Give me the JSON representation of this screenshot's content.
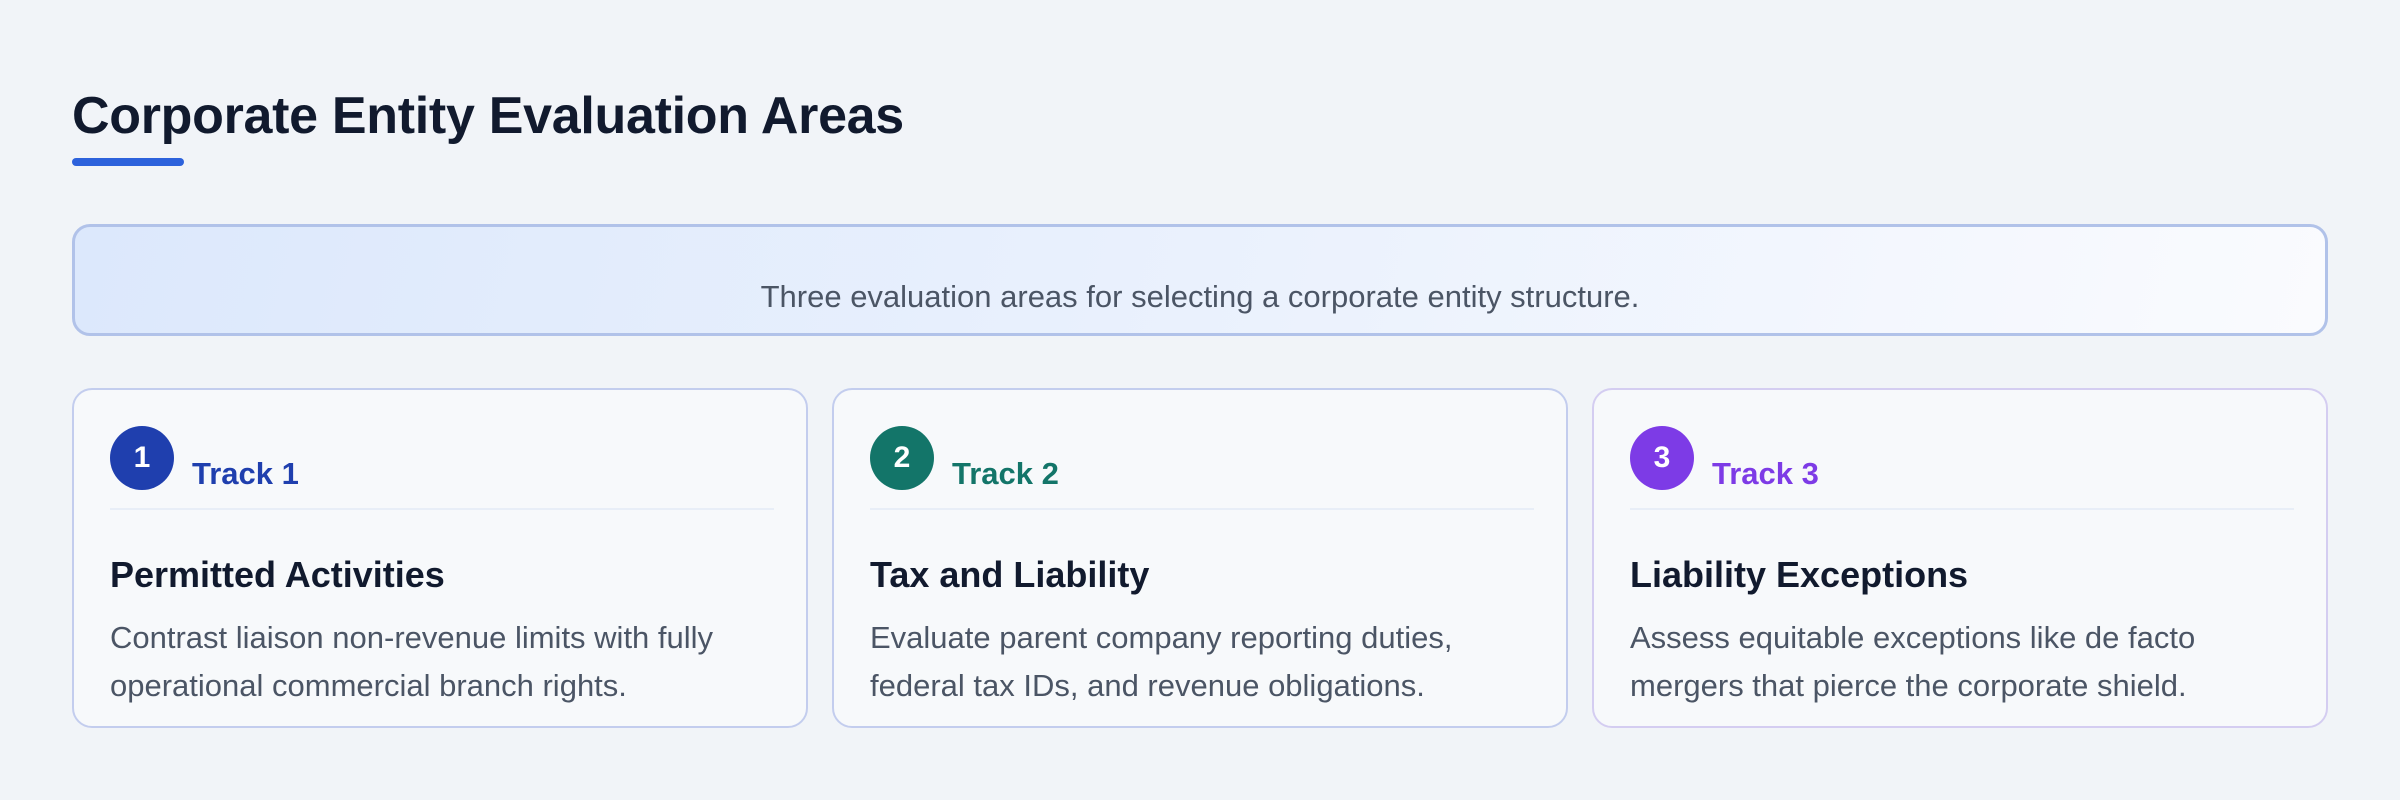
{
  "header": {
    "title": "Corporate Entity Evaluation Areas",
    "accent_color": "#2d62dc"
  },
  "intro": {
    "text": "Three evaluation areas for selecting a corporate entity structure."
  },
  "tracks": [
    {
      "number": "1",
      "label": "Track 1",
      "title": "Permitted Activities",
      "description": "Contrast liaison non-revenue limits with fully operational commercial branch rights.",
      "color": "#1f3fae"
    },
    {
      "number": "2",
      "label": "Track 2",
      "title": "Tax and Liability",
      "description": "Evaluate parent company reporting duties, federal tax IDs, and revenue obligations.",
      "color": "#137569"
    },
    {
      "number": "3",
      "label": "Track 3",
      "title": "Liability Exceptions",
      "description": "Assess equitable exceptions like de facto mergers that pierce the corporate shield.",
      "color": "#7d3be6"
    }
  ]
}
